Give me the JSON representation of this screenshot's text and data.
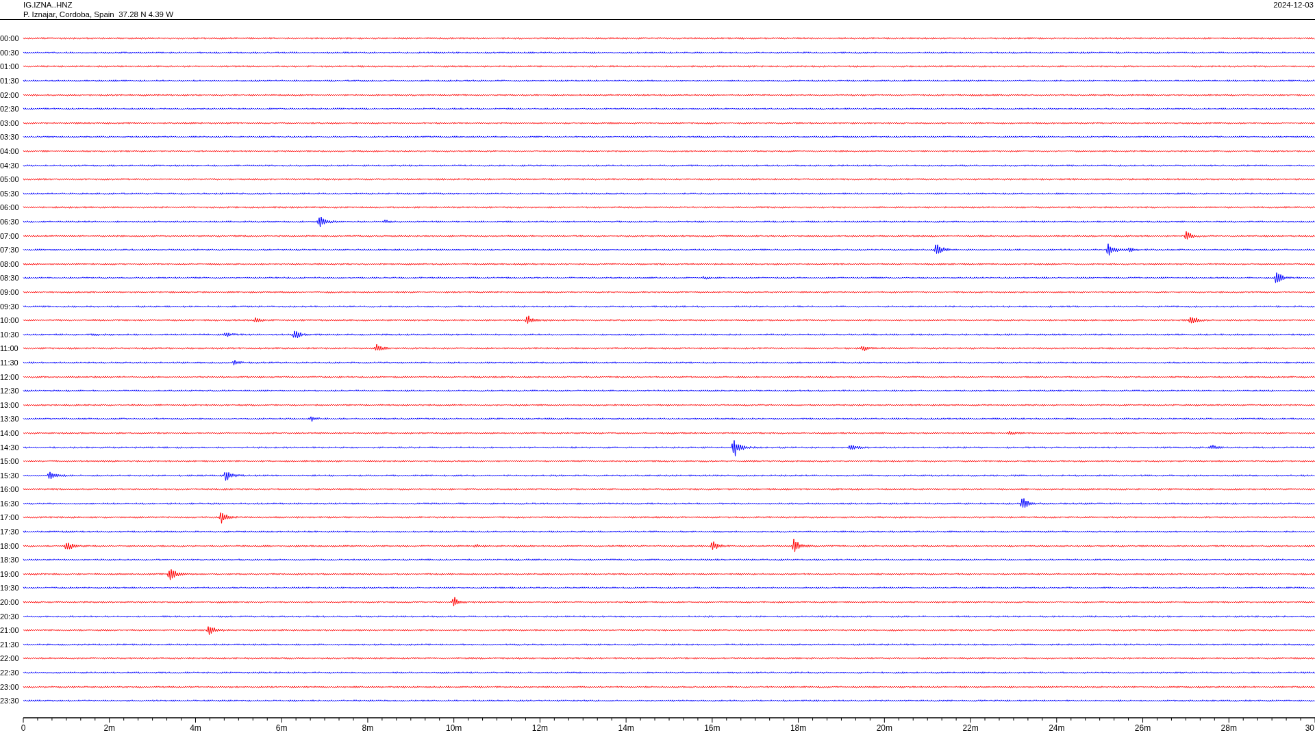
{
  "header": {
    "station": "IG.IZNA..HNZ",
    "location": "P. Iznajar, Cordoba, Spain  37.28 N 4.39 W",
    "date": "2024-12-03"
  },
  "rows": [
    {
      "time": "00:00",
      "color": "#ff0000"
    },
    {
      "time": "00:30",
      "color": "#0000ff"
    },
    {
      "time": "01:00",
      "color": "#ff0000"
    },
    {
      "time": "01:30",
      "color": "#0000ff"
    },
    {
      "time": "02:00",
      "color": "#ff0000"
    },
    {
      "time": "02:30",
      "color": "#0000ff"
    },
    {
      "time": "03:00",
      "color": "#ff0000"
    },
    {
      "time": "03:30",
      "color": "#0000ff"
    },
    {
      "time": "04:00",
      "color": "#ff0000"
    },
    {
      "time": "04:30",
      "color": "#0000ff"
    },
    {
      "time": "05:00",
      "color": "#ff0000"
    },
    {
      "time": "05:30",
      "color": "#0000ff"
    },
    {
      "time": "06:00",
      "color": "#ff0000"
    },
    {
      "time": "06:30",
      "color": "#0000ff"
    },
    {
      "time": "07:00",
      "color": "#ff0000"
    },
    {
      "time": "07:30",
      "color": "#0000ff"
    },
    {
      "time": "08:00",
      "color": "#ff0000"
    },
    {
      "time": "08:30",
      "color": "#0000ff"
    },
    {
      "time": "09:00",
      "color": "#ff0000"
    },
    {
      "time": "09:30",
      "color": "#0000ff"
    },
    {
      "time": "10:00",
      "color": "#ff0000"
    },
    {
      "time": "10:30",
      "color": "#0000ff"
    },
    {
      "time": "11:00",
      "color": "#ff0000"
    },
    {
      "time": "11:30",
      "color": "#0000ff"
    },
    {
      "time": "12:00",
      "color": "#ff0000"
    },
    {
      "time": "12:30",
      "color": "#0000ff"
    },
    {
      "time": "13:00",
      "color": "#ff0000"
    },
    {
      "time": "13:30",
      "color": "#0000ff"
    },
    {
      "time": "14:00",
      "color": "#ff0000"
    },
    {
      "time": "14:30",
      "color": "#0000ff"
    },
    {
      "time": "15:00",
      "color": "#ff0000"
    },
    {
      "time": "15:30",
      "color": "#0000ff"
    },
    {
      "time": "16:00",
      "color": "#ff0000"
    },
    {
      "time": "16:30",
      "color": "#0000ff"
    },
    {
      "time": "17:00",
      "color": "#ff0000"
    },
    {
      "time": "17:30",
      "color": "#0000ff"
    },
    {
      "time": "18:00",
      "color": "#ff0000"
    },
    {
      "time": "18:30",
      "color": "#0000ff"
    },
    {
      "time": "19:00",
      "color": "#ff0000"
    },
    {
      "time": "19:30",
      "color": "#0000ff"
    },
    {
      "time": "20:00",
      "color": "#ff0000"
    },
    {
      "time": "20:30",
      "color": "#0000ff"
    },
    {
      "time": "21:00",
      "color": "#ff0000"
    },
    {
      "time": "21:30",
      "color": "#0000ff"
    },
    {
      "time": "22:00",
      "color": "#ff0000"
    },
    {
      "time": "22:30",
      "color": "#0000ff"
    },
    {
      "time": "23:00",
      "color": "#ff0000"
    },
    {
      "time": "23:30",
      "color": "#0000ff"
    }
  ],
  "axis": {
    "labels": [
      "0",
      "2m",
      "4m",
      "6m",
      "8m",
      "10m",
      "12m",
      "14m",
      "16m",
      "18m",
      "20m",
      "22m",
      "24m",
      "26m",
      "28m",
      "30"
    ]
  }
}
